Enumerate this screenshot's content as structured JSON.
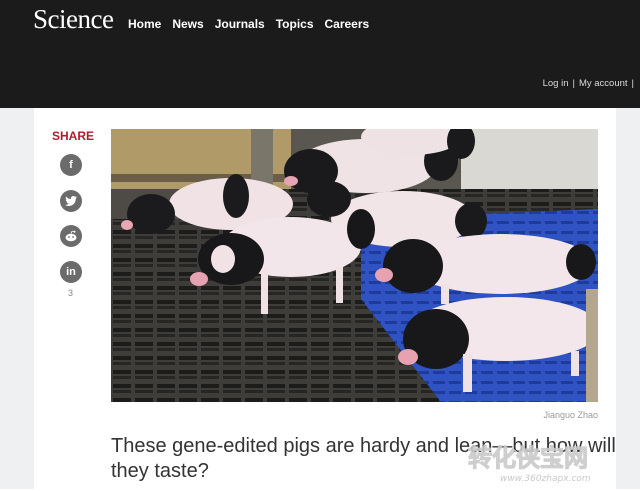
{
  "header": {
    "logo": "Science",
    "nav": [
      "Home",
      "News",
      "Journals",
      "Topics",
      "Careers"
    ],
    "login": "Log in",
    "account": "My account"
  },
  "share": {
    "title": "SHARE",
    "count": "3",
    "buttons": [
      {
        "icon": "facebook-icon",
        "glyph": "f"
      },
      {
        "icon": "twitter-icon",
        "glyph": "t"
      },
      {
        "icon": "reddit-icon",
        "glyph": "r"
      },
      {
        "icon": "linkedin-icon",
        "glyph": "in"
      }
    ]
  },
  "article": {
    "photo_credit": "Jianguo Zhao",
    "headline": "These gene-edited pigs are hardy and lean—but how will they taste?"
  },
  "watermark": {
    "line1": "转化侠宝网",
    "line2": "www.360zhapx.com"
  },
  "colors": {
    "header_bg": "#1b1b1c",
    "share_red": "#b01c2e",
    "gutter": "#eef0f1"
  }
}
